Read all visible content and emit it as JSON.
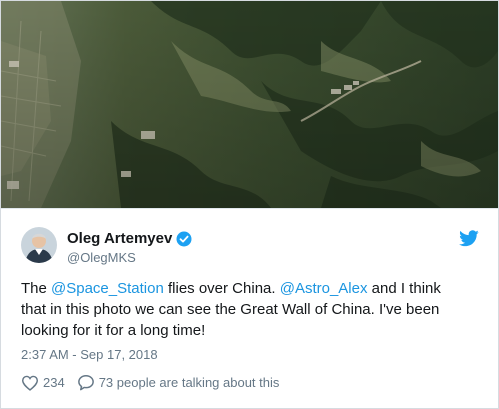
{
  "tweet": {
    "author_name": "Oleg Artemyev",
    "author_handle": "@OlegMKS",
    "text": {
      "p1": "The ",
      "mention1": "@Space_Station",
      "p2": " flies over China. ",
      "mention2": "@Astro_Alex",
      "p3": " and I think",
      "line2": "that in this photo we can see the Great Wall of China.  I've been",
      "line3": "looking for it for a long time!"
    },
    "timestamp": "2:37 AM - Sep 17, 2018",
    "like_count": "234",
    "reply_text": "73 people are talking about this"
  },
  "icons": {
    "verified": "verified-badge-icon",
    "brand": "twitter-bird-icon",
    "like": "heart-icon",
    "reply": "speech-bubble-icon"
  },
  "colors": {
    "accent": "#1da1f2",
    "mention": "#1b95e0",
    "muted": "#657786"
  }
}
